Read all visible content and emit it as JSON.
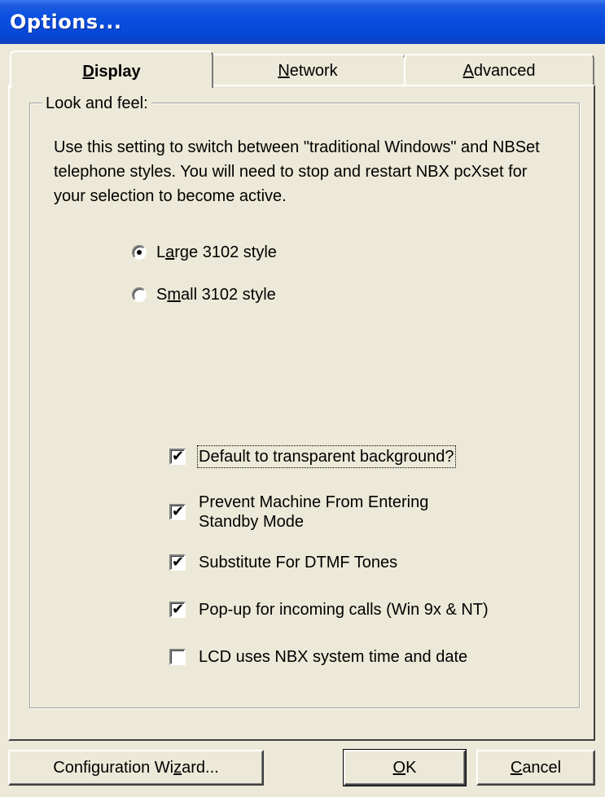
{
  "window": {
    "title": "Options..."
  },
  "tabs": [
    {
      "pre": "",
      "u": "D",
      "post": "isplay",
      "active": true
    },
    {
      "pre": "",
      "u": "N",
      "post": "etwork",
      "active": false
    },
    {
      "pre": "",
      "u": "A",
      "post": "dvanced",
      "active": false
    }
  ],
  "group": {
    "label": "Look and feel:"
  },
  "description": "Use this setting to switch between \"traditional Windows\" and NBSet telephone styles.  You will need to stop and restart NBX pcXset for your selection to become active.",
  "radios": [
    {
      "pre": "L",
      "u": "a",
      "post": "rge 3102 style",
      "checked": true
    },
    {
      "pre": "S",
      "u": "m",
      "post": "all 3102 style",
      "checked": false
    }
  ],
  "checkboxes": [
    {
      "label": "Default to transparent background?",
      "checked": true
    },
    {
      "label": "Prevent Machine From Entering Standby Mode",
      "checked": true
    },
    {
      "label": "Substitute For DTMF Tones",
      "checked": true
    },
    {
      "label": "Pop-up for incoming calls (Win 9x & NT)",
      "checked": true
    },
    {
      "label": "LCD uses NBX system time and date",
      "checked": false
    }
  ],
  "buttons": {
    "wizard": {
      "pre": "Configuration Wi",
      "u": "z",
      "post": "ard..."
    },
    "ok": {
      "pre": "",
      "u": "O",
      "post": "K"
    },
    "cancel": {
      "pre": "",
      "u": "C",
      "post": "ancel"
    }
  }
}
